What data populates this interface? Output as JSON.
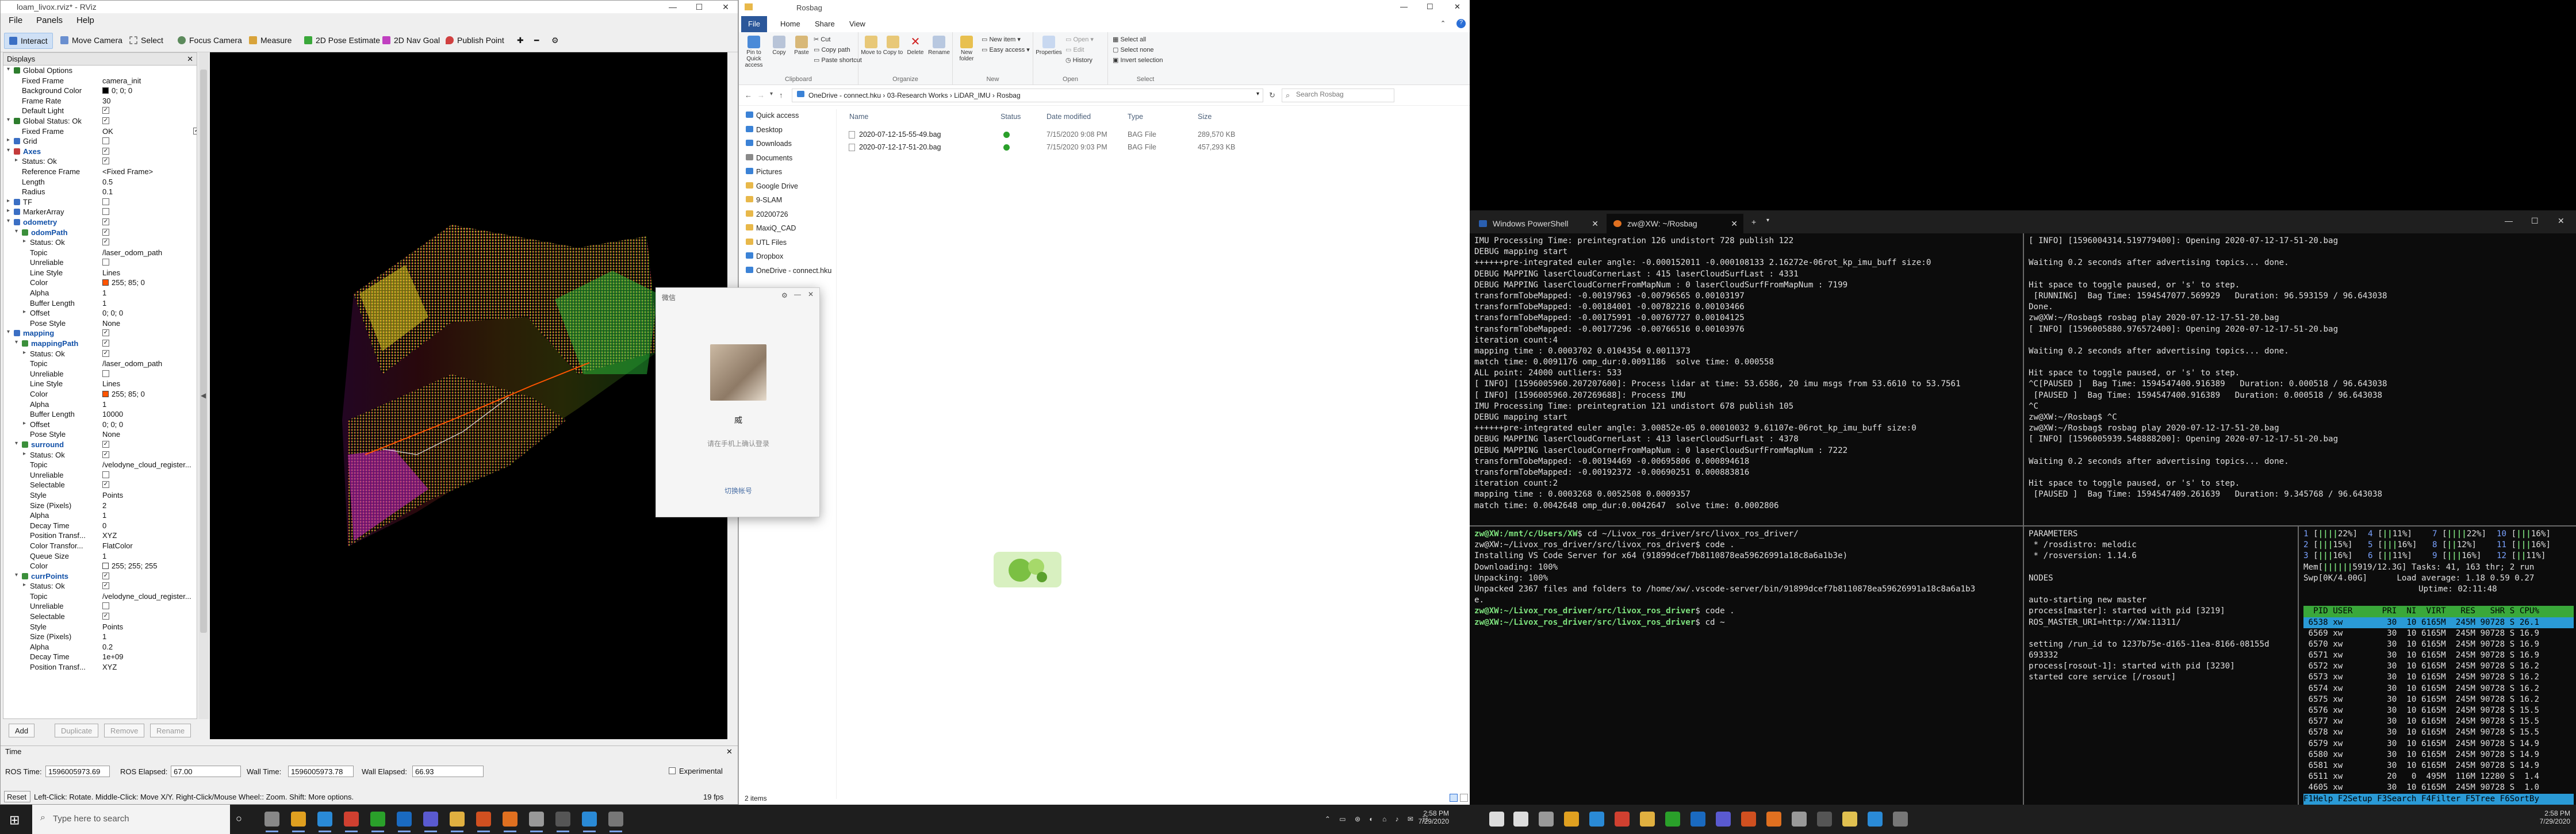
{
  "rviz": {
    "title": "loam_livox.rviz* - RViz",
    "menu": [
      "File",
      "Panels",
      "Help"
    ],
    "tools": [
      "Interact",
      "Move Camera",
      "Select",
      "Focus Camera",
      "Measure",
      "2D Pose Estimate",
      "2D Nav Goal",
      "Publish Point"
    ],
    "displays_title": "Displays",
    "tree": [
      {
        "label": "Global Options",
        "level": 0,
        "expand": "▾",
        "icon": "#2d7d2d"
      },
      {
        "label": "Fixed Frame",
        "level": 1,
        "value": "camera_init"
      },
      {
        "label": "Background Color",
        "level": 1,
        "value": "0; 0; 0",
        "swatch": "#000000"
      },
      {
        "label": "Frame Rate",
        "level": 1,
        "value": "30"
      },
      {
        "label": "Default Light",
        "level": 1,
        "check": "✓"
      },
      {
        "label": "Global Status: Ok",
        "level": 0,
        "expand": "▾",
        "icon": "#2d7d2d",
        "check": "✓"
      },
      {
        "label": "Fixed Frame",
        "level": 1,
        "value": "OK",
        "check": "✓"
      },
      {
        "label": "Grid",
        "level": 0,
        "expand": "▸",
        "icon": "#3b6fc4",
        "check": ""
      },
      {
        "label": "Axes",
        "level": 0,
        "expand": "▾",
        "icon": "#c43b3b",
        "check": "✓",
        "hl": true
      },
      {
        "label": "Status: Ok",
        "level": 1,
        "expand": "▸",
        "check": "✓"
      },
      {
        "label": "Reference Frame",
        "level": 1,
        "value": "<Fixed Frame>"
      },
      {
        "label": "Length",
        "level": 1,
        "value": "0.5"
      },
      {
        "label": "Radius",
        "level": 1,
        "value": "0.1"
      },
      {
        "label": "TF",
        "level": 0,
        "expand": "▸",
        "icon": "#3b6fc4",
        "check": ""
      },
      {
        "label": "MarkerArray",
        "level": 0,
        "expand": "▸",
        "icon": "#3b6fc4",
        "check": ""
      },
      {
        "label": "odometry",
        "level": 0,
        "expand": "▾",
        "icon": "#3b6fc4",
        "check": "✓",
        "hl": true
      },
      {
        "label": "odomPath",
        "level": 1,
        "expand": "▾",
        "icon": "#3b8f3b",
        "check": "✓",
        "hl": true
      },
      {
        "label": "Status: Ok",
        "level": 2,
        "expand": "▸",
        "check": "✓"
      },
      {
        "label": "Topic",
        "level": 2,
        "value": "/laser_odom_path"
      },
      {
        "label": "Unreliable",
        "level": 2,
        "check": ""
      },
      {
        "label": "Line Style",
        "level": 2,
        "value": "Lines"
      },
      {
        "label": "Color",
        "level": 2,
        "value": "255; 85; 0",
        "swatch": "#ff5500"
      },
      {
        "label": "Alpha",
        "level": 2,
        "value": "1"
      },
      {
        "label": "Buffer Length",
        "level": 2,
        "value": "1"
      },
      {
        "label": "Offset",
        "level": 2,
        "expand": "▸",
        "value": "0; 0; 0"
      },
      {
        "label": "Pose Style",
        "level": 2,
        "value": "None"
      },
      {
        "label": "mapping",
        "level": 0,
        "expand": "▾",
        "icon": "#3b6fc4",
        "check": "✓",
        "hl": true
      },
      {
        "label": "mappingPath",
        "level": 1,
        "expand": "▾",
        "icon": "#3b8f3b",
        "check": "✓",
        "hl": true
      },
      {
        "label": "Status: Ok",
        "level": 2,
        "expand": "▸",
        "check": "✓"
      },
      {
        "label": "Topic",
        "level": 2,
        "value": "/laser_odom_path"
      },
      {
        "label": "Unreliable",
        "level": 2,
        "check": ""
      },
      {
        "label": "Line Style",
        "level": 2,
        "value": "Lines"
      },
      {
        "label": "Color",
        "level": 2,
        "value": "255; 85; 0",
        "swatch": "#ff5500"
      },
      {
        "label": "Alpha",
        "level": 2,
        "value": "1"
      },
      {
        "label": "Buffer Length",
        "level": 2,
        "value": "10000"
      },
      {
        "label": "Offset",
        "level": 2,
        "expand": "▸",
        "value": "0; 0; 0"
      },
      {
        "label": "Pose Style",
        "level": 2,
        "value": "None"
      },
      {
        "label": "surround",
        "level": 1,
        "expand": "▾",
        "icon": "#3b8f3b",
        "check": "✓",
        "hl": true
      },
      {
        "label": "Status: Ok",
        "level": 2,
        "expand": "▸",
        "check": "✓"
      },
      {
        "label": "Topic",
        "level": 2,
        "value": "/velodyne_cloud_register..."
      },
      {
        "label": "Unreliable",
        "level": 2,
        "check": ""
      },
      {
        "label": "Selectable",
        "level": 2,
        "check": "✓"
      },
      {
        "label": "Style",
        "level": 2,
        "value": "Points"
      },
      {
        "label": "Size (Pixels)",
        "level": 2,
        "value": "2"
      },
      {
        "label": "Alpha",
        "level": 2,
        "value": "1"
      },
      {
        "label": "Decay Time",
        "level": 2,
        "value": "0"
      },
      {
        "label": "Position Transf...",
        "level": 2,
        "value": "XYZ"
      },
      {
        "label": "Color Transfor...",
        "level": 2,
        "value": "FlatColor"
      },
      {
        "label": "Queue Size",
        "level": 2,
        "value": "1"
      },
      {
        "label": "Color",
        "level": 2,
        "value": "255; 255; 255",
        "swatch": "#ffffff"
      },
      {
        "label": "currPoints",
        "level": 1,
        "expand": "▾",
        "icon": "#3b8f3b",
        "check": "✓",
        "hl": true
      },
      {
        "label": "Status: Ok",
        "level": 2,
        "expand": "▸",
        "check": "✓"
      },
      {
        "label": "Topic",
        "level": 2,
        "value": "/velodyne_cloud_register..."
      },
      {
        "label": "Unreliable",
        "level": 2,
        "check": ""
      },
      {
        "label": "Selectable",
        "level": 2,
        "check": "✓"
      },
      {
        "label": "Style",
        "level": 2,
        "value": "Points"
      },
      {
        "label": "Size (Pixels)",
        "level": 2,
        "value": "1"
      },
      {
        "label": "Alpha",
        "level": 2,
        "value": "0.2"
      },
      {
        "label": "Decay Time",
        "level": 2,
        "value": "1e+09"
      },
      {
        "label": "Position Transf...",
        "level": 2,
        "value": "XYZ"
      }
    ],
    "buttons": [
      "Add",
      "Duplicate",
      "Remove",
      "Rename"
    ],
    "time_title": "Time",
    "ros_time_label": "ROS Time:",
    "ros_time": "1596005973.69",
    "ros_elapsed_label": "ROS Elapsed:",
    "ros_elapsed": "67.00",
    "wall_time_label": "Wall Time:",
    "wall_time": "1596005973.78",
    "wall_elapsed_label": "Wall Elapsed:",
    "wall_elapsed": "66.93",
    "experimental": "Experimental",
    "reset": "Reset",
    "hint": "Left-Click: Rotate. Middle-Click: Move X/Y. Right-Click/Mouse Wheel:: Zoom. Shift: More options.",
    "fps": "19 fps"
  },
  "explorer": {
    "title": "Rosbag",
    "tabs": [
      "File",
      "Home",
      "Share",
      "View"
    ],
    "ribbon": {
      "pin": "Pin to Quick access",
      "copy": "Copy",
      "paste": "Paste",
      "cut": "Cut",
      "copy_path": "Copy path",
      "paste_shortcut": "Paste shortcut",
      "clipboard": "Clipboard",
      "move_to": "Move to",
      "copy_to": "Copy to",
      "delete": "Delete",
      "rename": "Rename",
      "organize": "Organize",
      "new_folder": "New folder",
      "new_item": "New item",
      "easy_access": "Easy access",
      "new": "New",
      "properties": "Properties",
      "open_btn": "Open",
      "edit": "Edit",
      "history": "History",
      "open": "Open",
      "select_all": "Select all",
      "select_none": "Select none",
      "invert": "Invert selection",
      "select": "Select"
    },
    "breadcrumb": [
      "OneDrive - connect.hku",
      "03-Research Works",
      "LiDAR_IMU",
      "Rosbag"
    ],
    "search_placeholder": "Search Rosbag",
    "nav": [
      {
        "label": "Quick access",
        "color": "#3b82d6"
      },
      {
        "label": "Desktop",
        "color": "#3b82d6"
      },
      {
        "label": "Downloads",
        "color": "#3b82d6"
      },
      {
        "label": "Documents",
        "color": "#8a8a8a"
      },
      {
        "label": "Pictures",
        "color": "#3b82d6"
      },
      {
        "label": "Google Drive",
        "color": "#e8b84a"
      },
      {
        "label": "9-SLAM",
        "color": "#e8b84a"
      },
      {
        "label": "20200726",
        "color": "#e8b84a"
      },
      {
        "label": "MaxiQ_CAD",
        "color": "#e8b84a"
      },
      {
        "label": "UTL Files",
        "color": "#e8b84a"
      },
      {
        "label": "Dropbox",
        "color": "#3b82d6"
      },
      {
        "label": "OneDrive - connect.hku",
        "color": "#3b82d6"
      }
    ],
    "columns": [
      "Name",
      "Status",
      "Date modified",
      "Type",
      "Size"
    ],
    "files": [
      {
        "name": "2020-07-12-15-55-49.bag",
        "date": "7/15/2020 9:08 PM",
        "type": "BAG File",
        "size": "289,570 KB"
      },
      {
        "name": "2020-07-12-17-51-20.bag",
        "date": "7/15/2020 9:03 PM",
        "type": "BAG File",
        "size": "457,293 KB"
      }
    ],
    "items": "2 items"
  },
  "dialog": {
    "title": "微信",
    "name": "威",
    "msg": "请在手机上确认登录",
    "switch": "切换帐号"
  },
  "terminal": {
    "tabs": [
      "Windows PowerShell",
      "zw@XW: ~/Rosbag"
    ],
    "left_top": [
      "IMU Processing Time: preintegration 126 undistort 728 publish 122",
      "DEBUG mapping start",
      "++++++pre-integrated euler angle: -0.000152011 -0.000108133 2.16272e-06rot_kp_imu_buff size:0",
      "DEBUG MAPPING laserCloudCornerLast : 415 laserCloudSurfLast : 4331",
      "DEBUG MAPPING laserCloudCornerFromMapNum : 0 laserCloudSurfFromMapNum : 7199",
      "transformTobeMapped: -0.00197963 -0.00796565 0.00103197",
      "transformTobeMapped: -0.00184001 -0.00782216 0.00103466",
      "transformTobeMapped: -0.00175991 -0.00767727 0.00104125",
      "transformTobeMapped: -0.00177296 -0.00766516 0.00103976",
      "iteration count:4",
      "mapping time : 0.0003702 0.0104354 0.0011373",
      "match time: 0.0091176 omp_dur:0.0091186  solve time: 0.000558",
      "ALL point: 24000 outliers: 533",
      "[ INFO] [1596005960.207207600]: Process lidar at time: 53.6586, 20 imu msgs from 53.6610 to 53.7561",
      "[ INFO] [1596005960.207269688]: Process IMU",
      "IMU Processing Time: preintegration 121 undistort 678 publish 105",
      "DEBUG mapping start",
      "++++++pre-integrated euler angle: 3.00852e-05 0.00010032 9.61107e-06rot_kp_imu_buff size:0",
      "DEBUG MAPPING laserCloudCornerLast : 413 laserCloudSurfLast : 4378",
      "DEBUG MAPPING laserCloudCornerFromMapNum : 0 laserCloudSurfFromMapNum : 7222",
      "transformTobeMapped: -0.00194469 -0.00695806 0.000894618",
      "transformTobeMapped: -0.00192372 -0.00690251 0.000883816",
      "iteration count:2",
      "mapping time : 0.0003268 0.0052508 0.0009357",
      "match time: 0.0042648 omp_dur:0.0042647  solve time: 0.0002806"
    ],
    "right_top": [
      "[ INFO] [1596004314.519779400]: Opening 2020-07-12-17-51-20.bag",
      "",
      "Waiting 0.2 seconds after advertising topics... done.",
      "",
      "Hit space to toggle paused, or 's' to step.",
      " [RUNNING]  Bag Time: 1594547077.569929   Duration: 96.593159 / 96.643038",
      "Done.",
      "zw@XW:~/Rosbag$ rosbag play 2020-07-12-17-51-20.bag",
      "[ INFO] [1596005880.976572400]: Opening 2020-07-12-17-51-20.bag",
      "",
      "Waiting 0.2 seconds after advertising topics... done.",
      "",
      "Hit space to toggle paused, or 's' to step.",
      "^C[PAUSED ]  Bag Time: 1594547400.916389   Duration: 0.000518 / 96.643038",
      " [PAUSED ]  Bag Time: 1594547400.916389   Duration: 0.000518 / 96.643038",
      "^C",
      "zw@XW:~/Rosbag$ ^C",
      "zw@XW:~/Rosbag$ rosbag play 2020-07-12-17-51-20.bag",
      "[ INFO] [1596005939.548888200]: Opening 2020-07-12-17-51-20.bag",
      "",
      "Waiting 0.2 seconds after advertising topics... done.",
      "",
      "Hit space to toggle paused, or 's' to step.",
      " [PAUSED ]  Bag Time: 1594547409.261639   Duration: 9.345768 / 96.643038"
    ],
    "left_bottom": [
      {
        "p": "zw@XW:/mnt/c/Users/XW",
        "c": "$ cd ~/Livox_ros_driver/src/livox_ros_driver/"
      },
      {
        "t": "zw@XW:~/Livox_ros_driver/src/livox_ros_driver$ code ."
      },
      {
        "t": "Installing VS Code Server for x64 (91899dcef7b8110878ea59626991a18c8a6a1b3e)"
      },
      {
        "t": "Downloading: 100%"
      },
      {
        "t": "Unpacking: 100%"
      },
      {
        "t": "Unpacked 2367 files and folders to /home/xw/.vscode-server/bin/91899dcef7b8110878ea59626991a18c8a6a1b3"
      },
      {
        "t": "e."
      },
      {
        "p": "zw@XW:~/Livox_ros_driver/src/livox_ros_driver",
        "c": "$ code ."
      },
      {
        "p": "zw@XW:~/Livox_ros_driver/src/livox_ros_driver",
        "c": "$ cd ~"
      }
    ],
    "middle_bottom": [
      "PARAMETERS",
      " * /rosdistro: melodic",
      " * /rosversion: 1.14.6",
      "",
      "NODES",
      "",
      "auto-starting new master",
      "process[master]: started with pid [3219]",
      "ROS_MASTER_URI=http://XW:11311/",
      "",
      "setting /run_id to 1237b75e-d165-11ea-8166-08155d",
      "693332",
      "process[rosout-1]: started with pid [3230]",
      "started core service [/rosout]"
    ],
    "htop": {
      "cpus": [
        {
          "n": "1",
          "pct": "22"
        },
        {
          "n": "4",
          "pct": "11"
        },
        {
          "n": "7",
          "pct": "22"
        },
        {
          "n": "10",
          "pct": "16"
        },
        {
          "n": "2",
          "pct": "15"
        },
        {
          "n": "5",
          "pct": "16"
        },
        {
          "n": "8",
          "pct": "12"
        },
        {
          "n": "11",
          "pct": "16"
        },
        {
          "n": "3",
          "pct": "16"
        },
        {
          "n": "6",
          "pct": "11"
        },
        {
          "n": "9",
          "pct": "16"
        },
        {
          "n": "12",
          "pct": "11"
        }
      ],
      "mem": "5919/12.3G",
      "swp": "0K/4.00G",
      "tasks": "Tasks: 41, 163 thr; 2 run",
      "load": "Load average: 1.18 0.59 0.27",
      "uptime": "Uptime: 02:11:48",
      "header": "  PID USER      PRI  NI  VIRT   RES   SHR S CPU%",
      "rows": [
        " 6538 xw         30  10 6165M  245M 90728 S 26.1",
        " 6569 xw         30  10 6165M  245M 90728 S 16.9",
        " 6570 xw         30  10 6165M  245M 90728 S 16.9",
        " 6571 xw         30  10 6165M  245M 90728 S 16.9",
        " 6572 xw         30  10 6165M  245M 90728 S 16.2",
        " 6573 xw         30  10 6165M  245M 90728 S 16.2",
        " 6574 xw         30  10 6165M  245M 90728 S 16.2",
        " 6575 xw         30  10 6165M  245M 90728 S 16.2",
        " 6576 xw         30  10 6165M  245M 90728 S 15.5",
        " 6577 xw         30  10 6165M  245M 90728 S 15.5",
        " 6578 xw         30  10 6165M  245M 90728 S 15.5",
        " 6579 xw         30  10 6165M  245M 90728 S 14.9",
        " 6580 xw         30  10 6165M  245M 90728 S 14.9",
        " 6581 xw         30  10 6165M  245M 90728 S 14.9",
        " 6511 xw         20   0  495M  116M 12280 S  1.4",
        " 4605 xw         30  10 6165M  245M 90728 S  1.0"
      ],
      "fkeys": "F1Help F2Setup F3Search F4Filter F5Tree F6SortBy"
    }
  },
  "taskbar": {
    "search": "Type here to search",
    "time1": "2:58 PM",
    "date1": "7/29/2020",
    "time2": "2:58 PM",
    "date2": "7/29/2020"
  }
}
